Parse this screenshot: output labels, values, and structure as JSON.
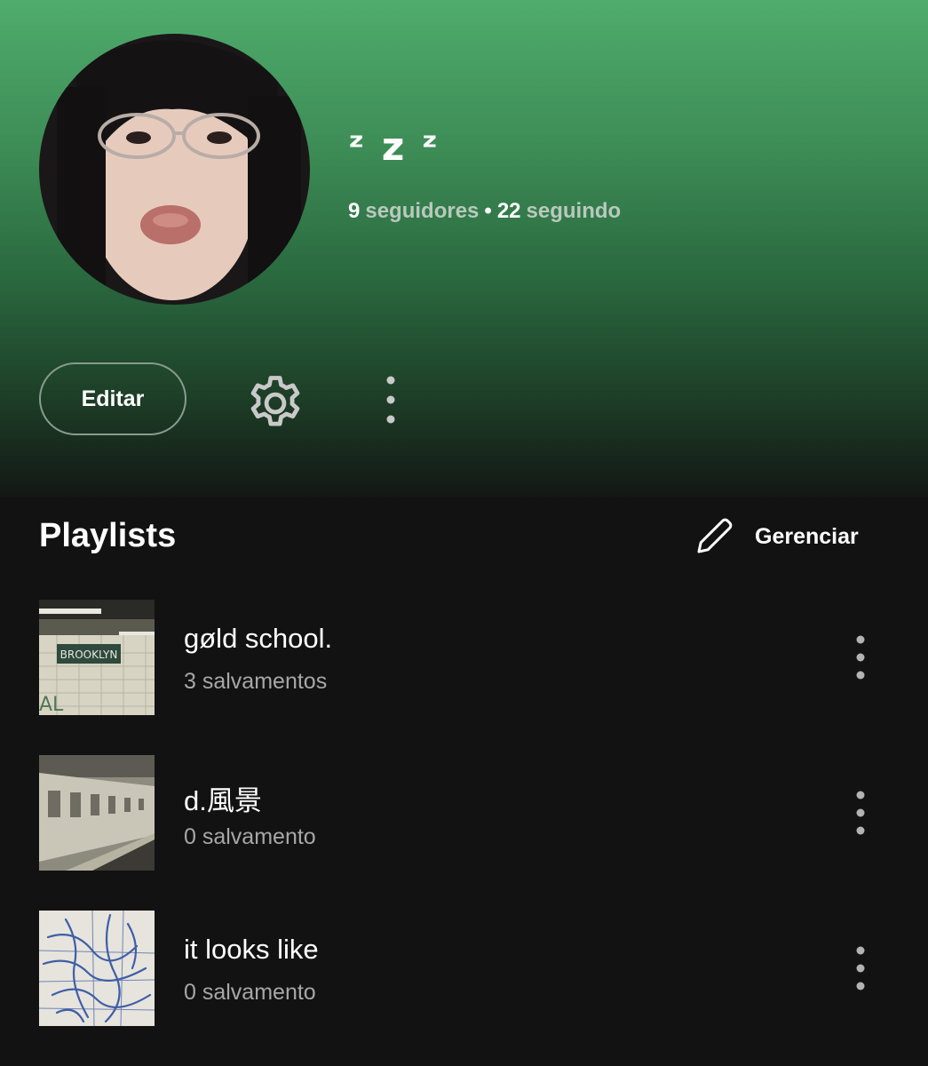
{
  "profile": {
    "name": "ᶻz  ᶻ",
    "name_display": "ᶻ z ᶻ",
    "followers_count": "9",
    "followers_label": "seguidores",
    "separator": "•",
    "following_count": "22",
    "following_label": "seguindo"
  },
  "actions": {
    "edit_label": "Editar",
    "settings_icon": "gear-icon",
    "more_icon": "more-vertical-icon"
  },
  "playlists_section": {
    "title": "Playlists",
    "manage_label": "Gerenciar",
    "manage_icon": "pencil-icon"
  },
  "playlists": [
    {
      "name": "gøld school.",
      "saves": "3 salvamentos",
      "cover_sign": "BROOKLYN"
    },
    {
      "name": "d.風景",
      "saves": "0 salvamento"
    },
    {
      "name": "it looks like",
      "saves": "0 salvamento"
    }
  ],
  "colors": {
    "gradient_top": "#4fac6c",
    "background": "#121212",
    "secondary_text": "#a7a7a7"
  }
}
